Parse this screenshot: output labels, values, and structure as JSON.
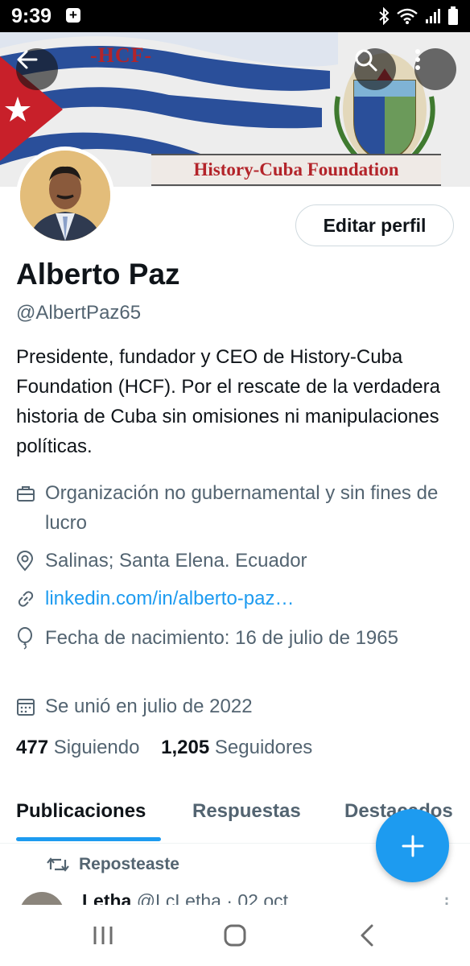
{
  "status_bar": {
    "time": "9:39"
  },
  "banner": {
    "tag": "-HCF-",
    "foundation_name": "History-Cuba Foundation"
  },
  "profile": {
    "edit_button": "Editar perfil",
    "name": "Alberto Paz",
    "handle": "@AlbertPaz65",
    "bio": "Presidente, fundador y CEO de History-Cuba Foundation (HCF). Por el rescate de la verdadera historia de Cuba sin omisiones ni manipulaciones políticas.",
    "category": "Organización no gubernamental y sin fines de lucro",
    "location": "Salinas; Santa Elena. Ecuador",
    "website": "linkedin.com/in/alberto-paz…",
    "birthdate": "Fecha de nacimiento: 16 de julio de 1965",
    "joined": "Se unió en julio de 2022",
    "following_count": "477",
    "following_label": "Siguiendo",
    "followers_count": "1,205",
    "followers_label": "Seguidores"
  },
  "tabs": [
    "Publicaciones",
    "Respuestas",
    "Destacados"
  ],
  "feed": {
    "repost_label": "Reposteaste",
    "first_post": {
      "author": "Letha",
      "meta": "@LcLetha · 02 oct"
    }
  },
  "colors": {
    "accent": "#1d9bf0",
    "text": "#0f1419",
    "secondary": "#536471"
  }
}
